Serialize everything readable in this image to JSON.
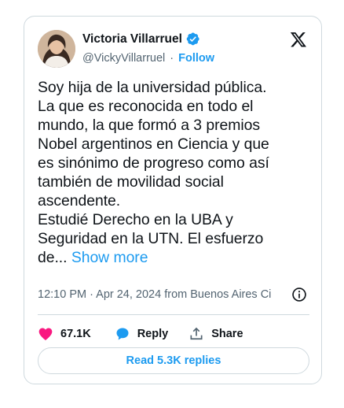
{
  "author": {
    "name": "Victoria Villarruel",
    "handle": "@VickyVillarruel",
    "separator": "·",
    "follow_label": "Follow"
  },
  "tweet": {
    "text": "Soy hija de la universidad pública.\nLa que es reconocida en todo el\nmundo, la que formó a 3 premios\nNobel argentinos en Ciencia y que\nes sinónimo de progreso como así\ntambién de movilidad social\nascendente.\nEstudié Derecho en la UBA y\nSeguridad en la UTN. El esfuerzo\nde...",
    "show_more": "Show more",
    "meta": "12:10 PM · Apr 24, 2024 from Buenos Aires Ci"
  },
  "actions": {
    "like_count": "67.1K",
    "reply_label": "Reply",
    "share_label": "Share"
  },
  "read_replies_label": "Read 5.3K replies",
  "colors": {
    "accent": "#1d9bf0",
    "like": "#f91880",
    "text": "#0f1419",
    "secondary": "#536471",
    "border": "#cfd9de"
  },
  "icons": {
    "verified": "verified-badge-icon",
    "logo": "x-logo-icon",
    "info": "info-icon",
    "like": "heart-icon",
    "reply": "speech-bubble-icon",
    "share": "share-upload-icon"
  }
}
